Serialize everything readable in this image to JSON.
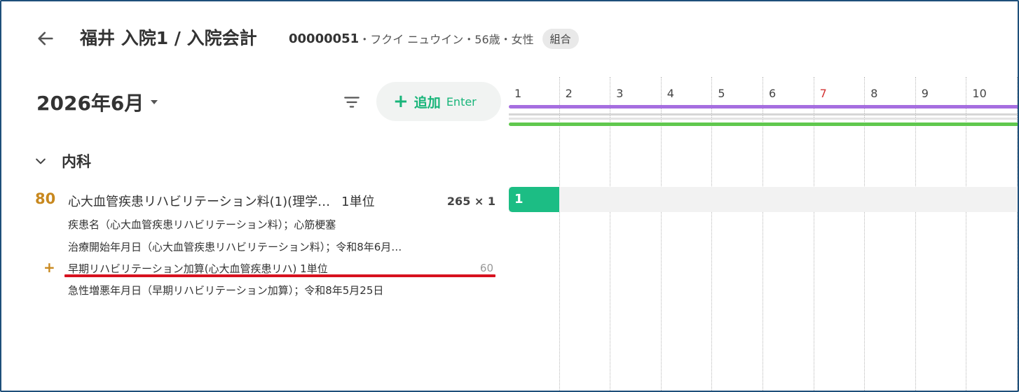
{
  "header": {
    "title": "福井 入院1 / 入院会計",
    "patient_id": "00000051",
    "patient_details": "・フクイ ニュウイン・56歳・女性",
    "insurance_badge": "組合"
  },
  "toolbar": {
    "month_label": "2026年6月",
    "add_label": "追加",
    "add_shortcut": "Enter"
  },
  "department": {
    "label": "内科"
  },
  "item": {
    "code": "80",
    "name": "心大血管疾患リハビリテーション料(1)(理学…",
    "unit": "1単位",
    "points": "265 × 1",
    "comments": [
      "疾患名（心大血管疾患リハビリテーション料）；心筋梗塞",
      "治療開始年月日（心大血管疾患リハビリテーション料）；令和8年6月…"
    ],
    "sub_item": {
      "name": "早期リハビリテーション加算(心大血管疾患リハ) 1単位",
      "points": "60"
    },
    "sub_comment": "急性増悪年月日（早期リハビリテーション加算）；令和8年5月25日"
  },
  "calendar": {
    "days": [
      "1",
      "2",
      "3",
      "4",
      "5",
      "6",
      "7",
      "8",
      "9",
      "10"
    ],
    "highlight_day": "7",
    "highlight_color": "#d33333",
    "band_colors": [
      "#a66ee0",
      "#d6d6d6",
      "#e3e3e3",
      "#60c84e"
    ],
    "count_day_1": "1",
    "count_color": "#1cbd84"
  }
}
